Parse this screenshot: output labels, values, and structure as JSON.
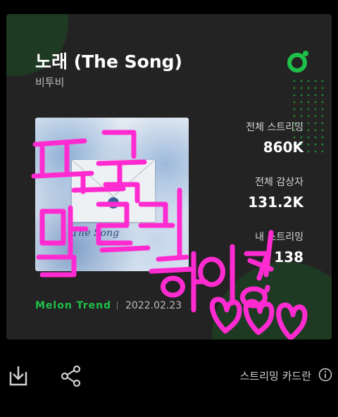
{
  "song": {
    "title": "노래 (The Song)",
    "artist": "비투비"
  },
  "album": {
    "cover_text": "The Song"
  },
  "stats": [
    {
      "label": "전체 스트리밍",
      "value": "860K"
    },
    {
      "label": "전체 감상자",
      "value": "131.2K"
    },
    {
      "label": "내 스트리밍",
      "value": "138"
    }
  ],
  "footer": {
    "trend": "Melon Trend",
    "date": "2022.02.23"
  },
  "bottom": {
    "card_label": "스트리밍 카드란"
  },
  "handwriting": {
    "lines": [
      "팬독",
      "멜로디",
      "화이팅!"
    ]
  },
  "colors": {
    "accent": "#1fc04a",
    "marker": "#ff2bd1",
    "card": "#232323"
  },
  "icons": [
    "melon-logo-icon",
    "download-icon",
    "share-icon",
    "info-icon"
  ]
}
